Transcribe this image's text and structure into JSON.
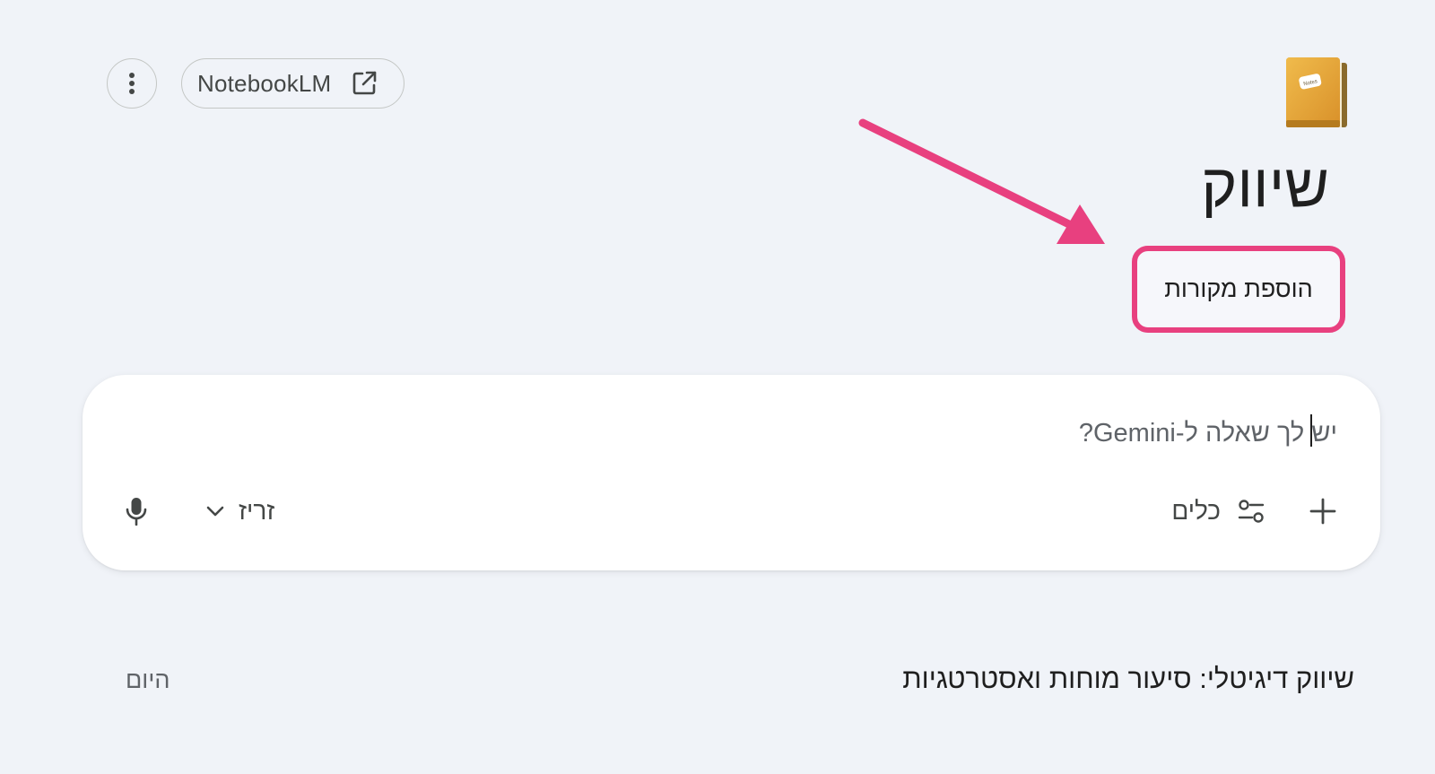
{
  "header": {
    "notebooklm_label": "NotebookLM"
  },
  "notebook": {
    "title": "שיווק",
    "add_sources_label": "הוספת מקורות",
    "icon": "notebook-icon",
    "icon_label": "Notes"
  },
  "composer": {
    "placeholder": "יש לך שאלה ל-Gemini?",
    "tools_label": "כלים",
    "mode_label": "זריז",
    "icons": [
      "plus-icon",
      "tools-sliders-icon",
      "chevron-down-icon",
      "microphone-icon"
    ]
  },
  "chats": [
    {
      "title": "שיווק דיגיטלי: סיעור מוחות ואסטרטגיות",
      "date": "היום"
    }
  ],
  "colors": {
    "background": "#f0f3f8",
    "highlight": "#e8407f",
    "composer_bg": "#ffffff"
  }
}
